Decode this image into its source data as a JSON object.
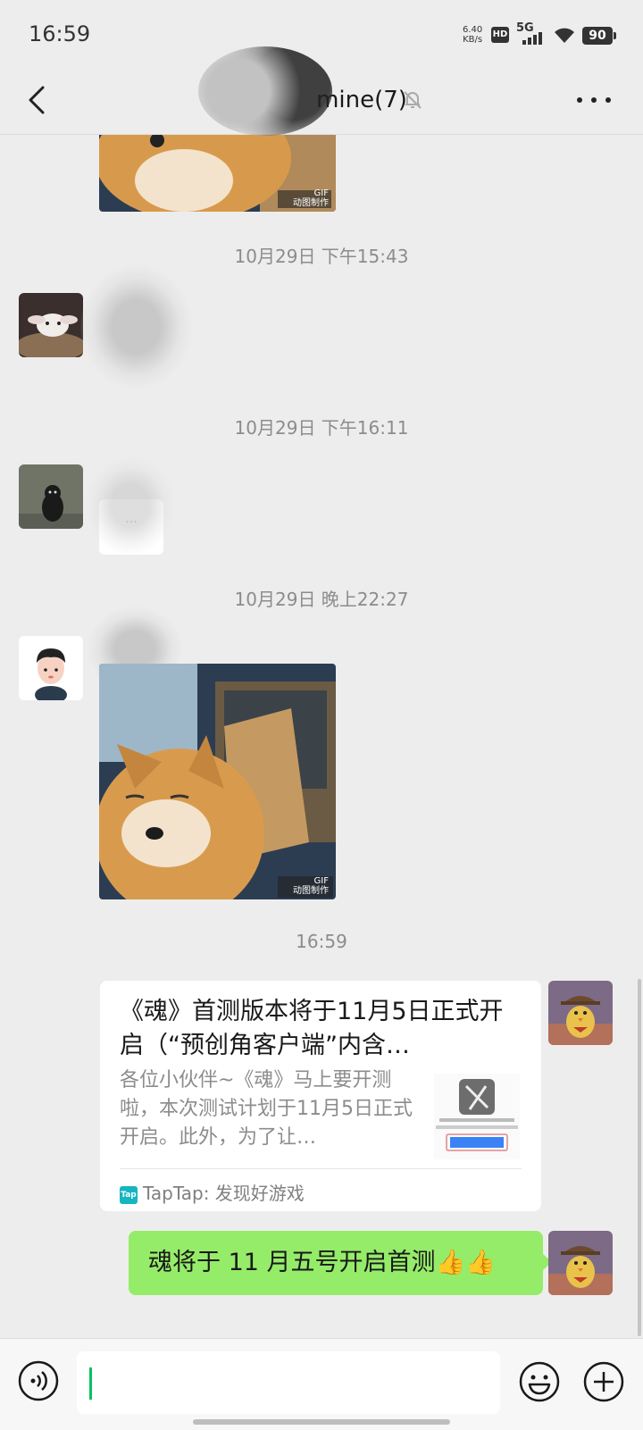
{
  "status_bar": {
    "time": "16:59",
    "net_speed_value": "6.40",
    "net_speed_unit": "KB/s",
    "hd_label": "HD",
    "network": "5G",
    "battery": "90"
  },
  "header": {
    "title": "mine(7)",
    "muted_icon": "bell-muted-icon",
    "back_icon": "chevron-left-icon",
    "more_icon": "more-dots-icon"
  },
  "messages": {
    "stamp1": "10月29日 下午15:43",
    "stamp2": "10月29日 下午16:11",
    "stamp3": "10月29日 晚上22:27",
    "stamp4": "16:59",
    "sticker_caption": "GIF",
    "sticker_caption_sub": "动图制作",
    "hidden_text_ellipsis": "···",
    "card": {
      "title": "《魂》首测版本将于11月5日正式开启（“预创角客户端”内含…",
      "description": "各位小伙伴~《魂》马上要开测啦，本次测试计划于11月5日正式开启。此外，为了让…",
      "source_icon_label": "Tap",
      "source": "TapTap: 发现好游戏"
    },
    "my_text": "魂将于 11 月五号开启首测👍👍"
  },
  "input_bar": {
    "voice_icon": "voice-icon",
    "emoji_icon": "emoji-icon",
    "plus_icon": "plus-icon"
  },
  "colors": {
    "bubble_green": "#95ec69",
    "background": "#ededed",
    "caret": "#07c160"
  }
}
